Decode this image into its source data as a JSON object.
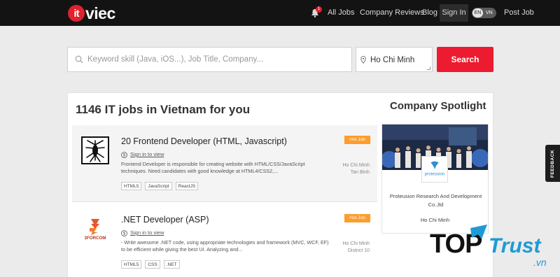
{
  "nav": {
    "logo_it": "it",
    "logo_viec": "viec",
    "notification_count": "1",
    "links": {
      "all_jobs": "All Jobs",
      "company_reviews": "Company Reviews",
      "blog": "Blog",
      "sign_in": "Sign In",
      "post_job": "Post Job"
    },
    "lang": {
      "en": "EN",
      "vn": "VN",
      "active": "EN"
    }
  },
  "search": {
    "keyword_placeholder": "Keyword skill (Java, iOS...), Job Title, Company...",
    "keyword_value": "",
    "location_value": "Ho Chi Minh",
    "button_label": "Search"
  },
  "results": {
    "heading": "1146 IT jobs in Vietnam for you"
  },
  "jobs": [
    {
      "title": "20 Frontend Developer (HTML, Javascript)",
      "salary": "Sign in to view",
      "description": "Frontend Developer is responsible for creating website with HTML/CSS/JavaScript techniques. Need candidates with good knowledge at HTML4/CSS2,...",
      "tags": [
        "HTML5",
        "JavaScript",
        "ReactJS"
      ],
      "badge": "Hot Job",
      "city": "Ho Chi Minh",
      "district": "Tan Binh"
    },
    {
      "title": ".NET Developer (ASP)",
      "salary": "Sign in to view",
      "description": "- Write awesome .NET code, using appropriate technologies and framework (MVC, WCF, EF) to be efficient while giving the best UI. Analyzing and...",
      "tags": [
        "HTML5",
        "CSS",
        ".NET"
      ],
      "badge": "Hot Job",
      "city": "Ho Chi Minh",
      "district": "District 10",
      "company_logo_text": "3FORCOM"
    }
  ],
  "spotlight": {
    "heading": "Company Spotlight",
    "company_logo_text": "proteusion",
    "company_name": "Proteusion Research And Development Co.,ltd",
    "city": "Ho Chi Minh"
  },
  "feedback": {
    "label": "FEEDBACK"
  },
  "watermark": {
    "text_top": "TOP",
    "text_trust": "Trust",
    "text_vn": ".vn"
  },
  "colors": {
    "nav_bg": "#131313",
    "brand_red": "#ed1b2f",
    "hot_badge": "#ff9c2a",
    "page_bg": "#ebebeb",
    "watermark_blue": "#1e9ad6"
  }
}
